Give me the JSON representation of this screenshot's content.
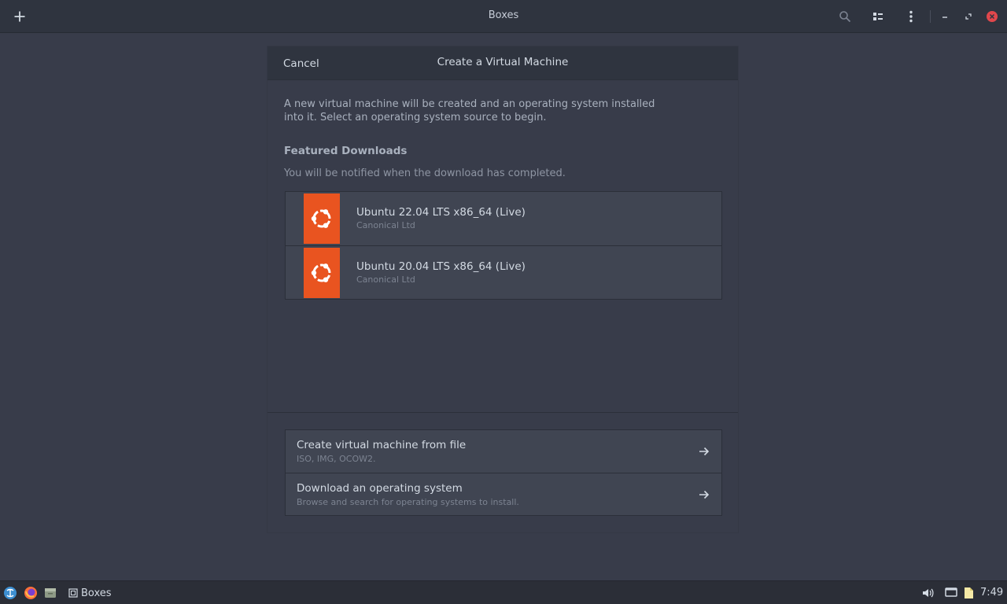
{
  "window": {
    "title": "Boxes"
  },
  "dialog": {
    "cancel_label": "Cancel",
    "title": "Create a Virtual Machine",
    "intro": "A new virtual machine will be created and an operating system installed into it. Select an operating system source to begin.",
    "intro_line1": "A new virtual machine will be created and an operating system installed",
    "intro_line2": "into it. Select an operating system source to begin.",
    "featured_heading": "Featured Downloads",
    "notify_text": "You will be notified when the download has completed.",
    "featured": [
      {
        "name": "Ubuntu 22.04 LTS x86_64 (Live)",
        "vendor": "Canonical Ltd"
      },
      {
        "name": "Ubuntu 20.04 LTS x86_64 (Live)",
        "vendor": "Canonical Ltd"
      }
    ],
    "actions": [
      {
        "title": "Create virtual machine from file",
        "subtitle": "ISO, IMG, OCOW2."
      },
      {
        "title": "Download an operating system",
        "subtitle": "Browse and search for operating systems to install."
      }
    ]
  },
  "taskbar": {
    "task_label": "Boxes",
    "clock": "7:49"
  },
  "icons": {
    "add": "plus-icon",
    "search": "search-icon",
    "view": "list-view-icon",
    "menu": "kebab-menu-icon",
    "minimize": "minimize-icon",
    "maximize": "maximize-icon",
    "close": "close-icon",
    "os_logo": "ubuntu-logo-icon",
    "arrow": "arrow-right-icon"
  },
  "colors": {
    "ubuntu_orange": "#e95420",
    "close_red": "#e0474c",
    "background": "#383c4a",
    "header": "#2f343f"
  }
}
